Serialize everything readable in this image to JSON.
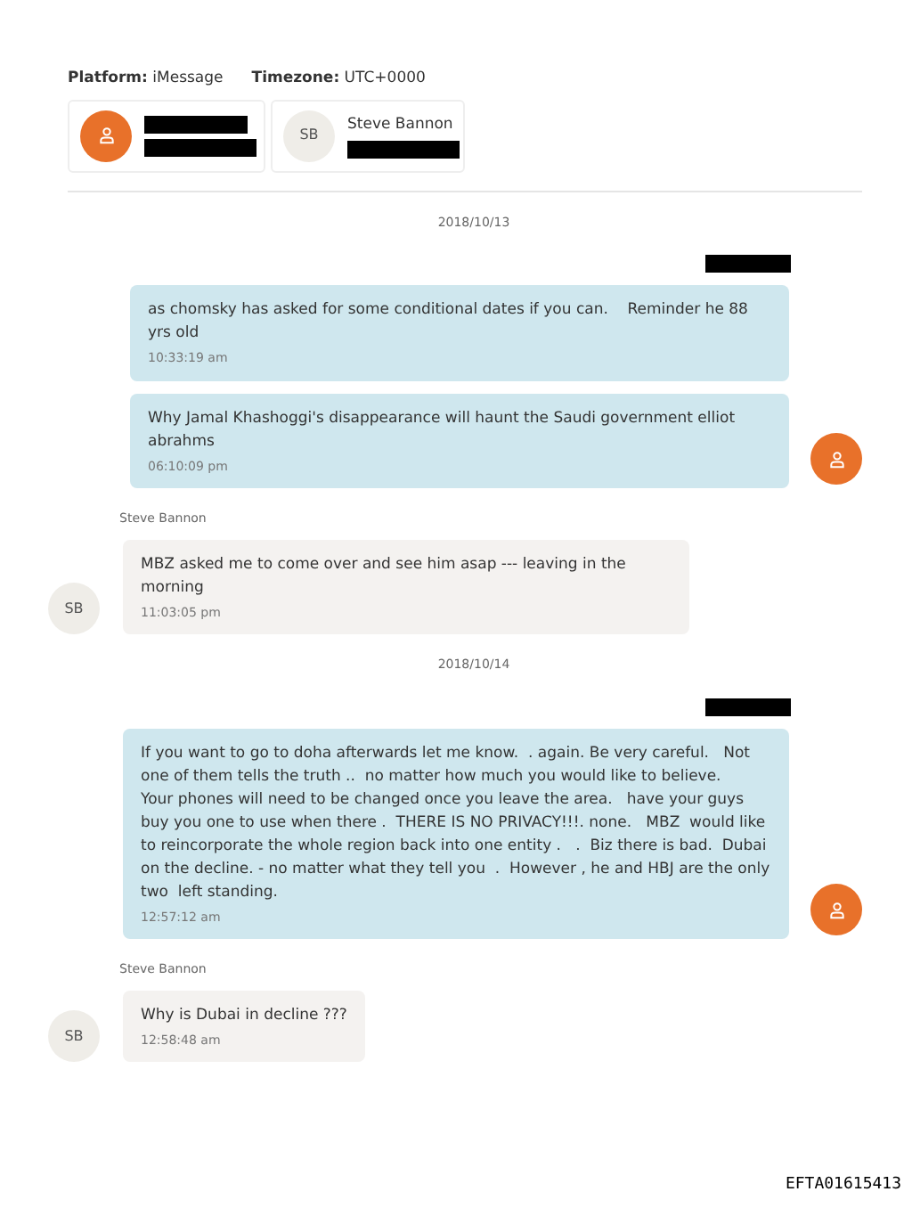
{
  "header": {
    "platform_label": "Platform:",
    "platform": "iMessage",
    "timezone_label": "Timezone:",
    "timezone": "UTC+0000"
  },
  "participants": [
    {
      "kind": "redacted"
    },
    {
      "kind": "named",
      "initials": "SB",
      "name": "Steve Bannon"
    }
  ],
  "items": [
    {
      "kind": "date",
      "text": "2018/10/13"
    },
    {
      "kind": "outgoing",
      "messages": [
        {
          "text": "as chomsky has asked for some conditional dates if you can.    Reminder he 88 yrs old",
          "time": "10:33:19 am"
        },
        {
          "text": "Why Jamal Khashoggi's disappearance will haunt the Saudi government elliot abrahms",
          "time": "06:10:09 pm"
        }
      ]
    },
    {
      "kind": "incoming",
      "sender": "Steve Bannon",
      "initials": "SB",
      "messages": [
        {
          "text": "MBZ asked me to come over and see him asap --- leaving in the morning",
          "time": "11:03:05 pm"
        }
      ]
    },
    {
      "kind": "date",
      "text": "2018/10/14"
    },
    {
      "kind": "outgoing",
      "messages": [
        {
          "text": "If you want to go to doha afterwards let me know.  . again. Be very careful.   Not one of them tells the truth ..  no matter how much you would like to believe.    Your phones will need to be changed once you leave the area.   have your guys buy you one to use when there .  THERE IS NO PRIVACY!!!. none.   MBZ  would like to reincorporate the whole region back into one entity .   .  Biz there is bad.  Dubai on the decline. - no matter what they tell you  .  However , he and HBJ are the only two  left standing.",
          "time": "12:57:12 am"
        }
      ]
    },
    {
      "kind": "incoming",
      "sender": "Steve Bannon",
      "initials": "SB",
      "messages": [
        {
          "text": "Why is Dubai in decline ???",
          "time": "12:58:48 am"
        }
      ]
    }
  ],
  "footer": "EFTA01615413"
}
